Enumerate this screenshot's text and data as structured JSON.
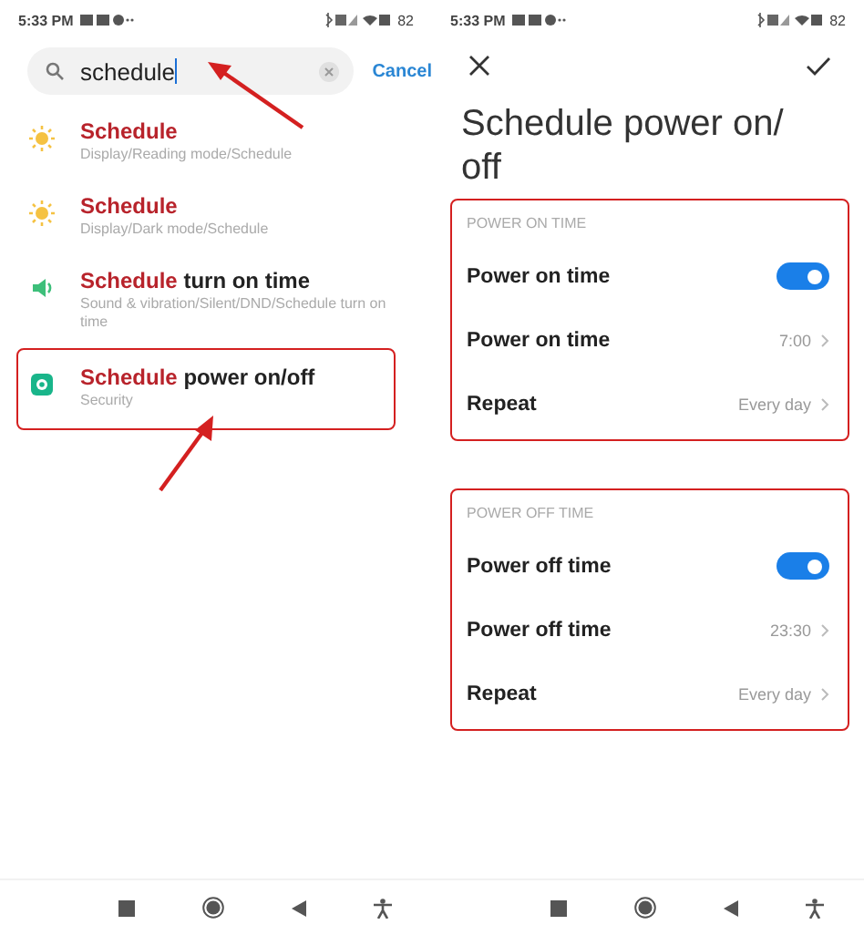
{
  "left_screen": {
    "status_bar": {
      "time": "5:33 PM",
      "battery": "82"
    },
    "search": {
      "value": "schedule"
    },
    "cancel": "Cancel",
    "results": [
      {
        "kind": "sun",
        "match": "Schedule",
        "path": "Display/Reading mode/Schedule",
        "highlighted": false
      },
      {
        "kind": "sun",
        "match": "Schedule",
        "path": "Display/Dark mode/Schedule",
        "highlighted": false
      },
      {
        "kind": "speaker",
        "match": "Schedule",
        "rest": " turn on time",
        "path": "Sound & vibration/Silent/DND/Schedule turn on time",
        "highlighted": false
      },
      {
        "kind": "shield",
        "match": "Schedule",
        "rest": " power on/off",
        "path": "Security",
        "highlighted": true
      }
    ]
  },
  "right_screen": {
    "status_bar": {
      "time": "5:33 PM",
      "battery": "82"
    },
    "title": "Schedule power on/ off",
    "sections": [
      {
        "header": "POWER ON TIME",
        "highlighted": true,
        "rows": [
          {
            "kind": "toggle",
            "label": "Power on time",
            "on": true
          },
          {
            "kind": "value",
            "label": "Power on time",
            "value": "7:00"
          },
          {
            "kind": "value",
            "label": "Repeat",
            "value": "Every day"
          }
        ]
      },
      {
        "header": "POWER OFF TIME",
        "highlighted": true,
        "rows": [
          {
            "kind": "toggle",
            "label": "Power off time",
            "on": true
          },
          {
            "kind": "value",
            "label": "Power off time",
            "value": "23:30"
          },
          {
            "kind": "value",
            "label": "Repeat",
            "value": "Every day"
          }
        ]
      }
    ]
  }
}
